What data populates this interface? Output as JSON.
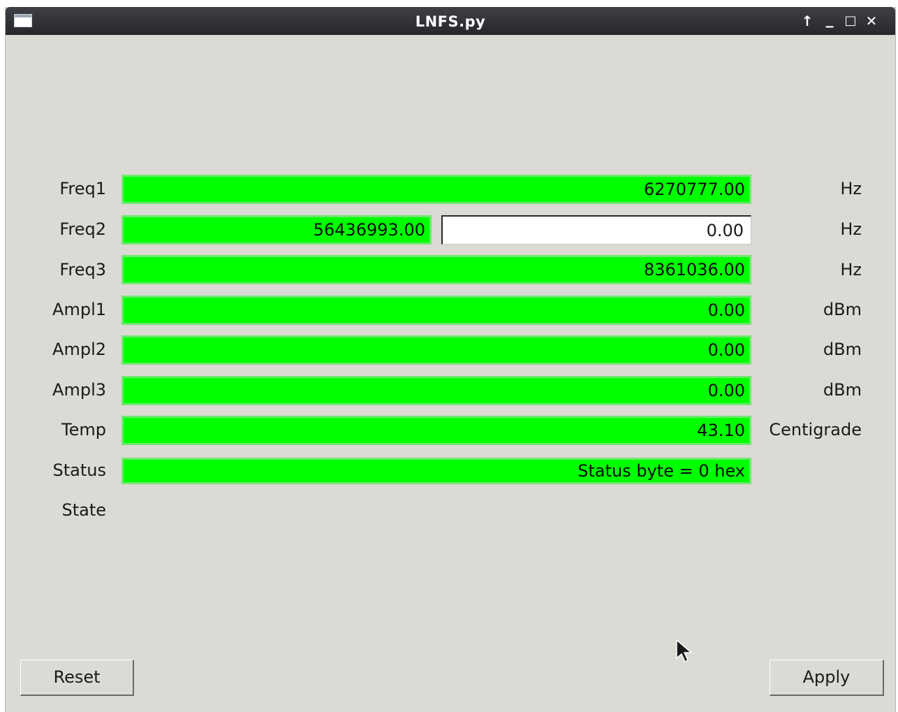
{
  "window": {
    "title": "LNFS.py",
    "controls": {
      "up": "↑",
      "minimize": "▁",
      "maximize": "□",
      "close": "✕"
    }
  },
  "rows": [
    {
      "label": "Freq1",
      "value": "6270777.00",
      "unit": "Hz"
    },
    {
      "label": "Freq2",
      "value": "56436993.00",
      "input_value": "0.00",
      "unit": "Hz"
    },
    {
      "label": "Freq3",
      "value": "8361036.00",
      "unit": "Hz"
    },
    {
      "label": "Ampl1",
      "value": "0.00",
      "unit": "dBm"
    },
    {
      "label": "Ampl2",
      "value": "0.00",
      "unit": "dBm"
    },
    {
      "label": "Ampl3",
      "value": "0.00",
      "unit": "dBm"
    },
    {
      "label": "Temp",
      "value": "43.10",
      "unit": "Centigrade"
    },
    {
      "label": "Status",
      "value": "Status byte = 0 hex"
    },
    {
      "label": "State"
    }
  ],
  "buttons": {
    "reset": "Reset",
    "apply": "Apply"
  },
  "colors": {
    "field_ok": "#00ff00",
    "background": "#dcdad5",
    "titlebar": "#2b2d31"
  }
}
